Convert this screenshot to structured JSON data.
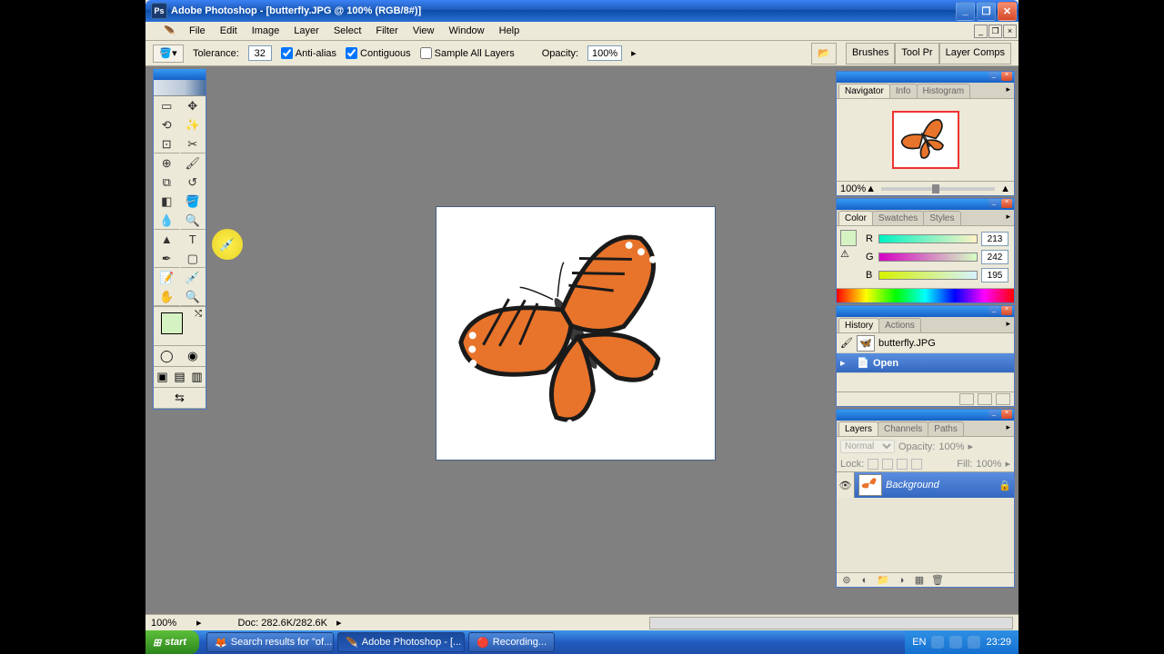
{
  "window": {
    "title": "Adobe Photoshop - [butterfly.JPG @ 100% (RGB/8#)]"
  },
  "menu": {
    "items": [
      "File",
      "Edit",
      "Image",
      "Layer",
      "Select",
      "Filter",
      "View",
      "Window",
      "Help"
    ]
  },
  "options": {
    "tolerance_label": "Tolerance:",
    "tolerance_value": "32",
    "anti_alias": "Anti-alias",
    "contiguous": "Contiguous",
    "sample_all": "Sample All Layers",
    "opacity_label": "Opacity:",
    "opacity_value": "100%"
  },
  "palette_well": {
    "tabs": [
      "Brushes",
      "Tool Pr",
      "Layer Comps"
    ]
  },
  "navigator": {
    "tabs": [
      "Navigator",
      "Info",
      "Histogram"
    ],
    "zoom": "100%"
  },
  "color": {
    "tabs": [
      "Color",
      "Swatches",
      "Styles"
    ],
    "r_label": "R",
    "r_value": "213",
    "g_label": "G",
    "g_value": "242",
    "b_label": "B",
    "b_value": "195",
    "fg_color": "#d5f2c3"
  },
  "history": {
    "tabs": [
      "History",
      "Actions"
    ],
    "doc_name": "butterfly.JPG",
    "state": "Open"
  },
  "layers": {
    "tabs": [
      "Layers",
      "Channels",
      "Paths"
    ],
    "blend_mode": "Normal",
    "opacity_label": "Opacity:",
    "opacity_value": "100%",
    "lock_label": "Lock:",
    "fill_label": "Fill:",
    "fill_value": "100%",
    "items": [
      {
        "name": "Background",
        "locked": true
      }
    ]
  },
  "status": {
    "zoom": "100%",
    "doc": "Doc: 282.6K/282.6K"
  },
  "taskbar": {
    "start": "start",
    "tasks": [
      {
        "label": "Search results for \"of..."
      },
      {
        "label": "Adobe Photoshop - [..."
      },
      {
        "label": "Recording..."
      }
    ],
    "lang": "EN",
    "time": "23:29"
  }
}
